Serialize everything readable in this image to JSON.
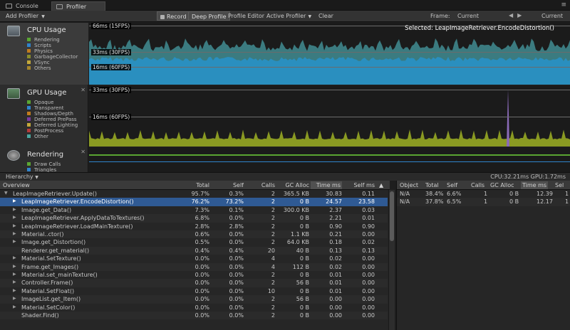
{
  "tabs": {
    "console": "Console",
    "profiler": "Profiler",
    "menu": "≡"
  },
  "toolbar": {
    "add_profiler": "Add Profiler",
    "record": "Record",
    "deep_profile": "Deep Profile",
    "profile_editor": "Profile Editor",
    "active_profiler": "Active Profiler",
    "clear": "Clear",
    "frame_label": "Frame:",
    "frame_value": "Current",
    "current_button": "Current"
  },
  "modules": {
    "cpu": {
      "title": "CPU Usage",
      "legend": [
        {
          "label": "Rendering",
          "color": "#5aa532"
        },
        {
          "label": "Scripts",
          "color": "#2f84cc"
        },
        {
          "label": "Physics",
          "color": "#c17c1d"
        },
        {
          "label": "GarbageCollector",
          "color": "#8a8d2c"
        },
        {
          "label": "VSync",
          "color": "#c3a83a"
        },
        {
          "label": "Others",
          "color": "#a6862b"
        }
      ]
    },
    "gpu": {
      "title": "GPU Usage",
      "legend": [
        {
          "label": "Opaque",
          "color": "#5aa532"
        },
        {
          "label": "Transparent",
          "color": "#2f84cc"
        },
        {
          "label": "Shadows/Depth",
          "color": "#c17c1d"
        },
        {
          "label": "Deferred PrePass",
          "color": "#7a3aa0"
        },
        {
          "label": "Deferred Lighting",
          "color": "#c3a83a"
        },
        {
          "label": "PostProcess",
          "color": "#b33a3a"
        },
        {
          "label": "Other",
          "color": "#4ba7a0"
        }
      ]
    },
    "rendering": {
      "title": "Rendering",
      "legend": [
        {
          "label": "Draw Calls",
          "color": "#5aa532"
        },
        {
          "label": "Triangles",
          "color": "#2f84cc"
        }
      ]
    }
  },
  "graphs": {
    "cpu_ref": [
      "66ms (15FPS)",
      "33ms (30FPS)",
      "16ms (60FPS)"
    ],
    "gpu_ref": [
      "33ms (30FPS)",
      "16ms (60FPS)"
    ],
    "selected": "Selected: LeapImageRetriever.EncodeDistortion()",
    "colors": {
      "cpu_fill": "#2a8fbf",
      "cpu_top": "#3b7b80",
      "gpu_fill": "#8a9a22",
      "gpu_spike": "#8a6ab8"
    }
  },
  "status": {
    "hierarchy": "Hierarchy",
    "cpu_gpu": "CPU:32.21ms   GPU:1.72ms"
  },
  "hierarchy": {
    "headers": {
      "overview": "Overview",
      "total": "Total",
      "self": "Self",
      "calls": "Calls",
      "gc_alloc": "GC Alloc",
      "time_ms": "Time ms",
      "self_ms": "Self ms",
      "sort": "▲"
    },
    "rows": [
      {
        "name": "LeapImageRetriever.Update()",
        "indent": 0,
        "expand": "open",
        "total": "95.7%",
        "self": "0.3%",
        "calls": "2",
        "gc": "365.5 KB",
        "time": "30.83",
        "selfms": "0.11"
      },
      {
        "name": "LeapImageRetriever.EncodeDistortion()",
        "indent": 1,
        "expand": "closed",
        "total": "76.2%",
        "self": "73.2%",
        "calls": "2",
        "gc": "0 B",
        "time": "24.57",
        "selfms": "23.58",
        "selected": true
      },
      {
        "name": "Image.get_Data()",
        "indent": 1,
        "expand": "closed",
        "total": "7.3%",
        "self": "0.1%",
        "calls": "2",
        "gc": "300.0 KB",
        "time": "2.37",
        "selfms": "0.03"
      },
      {
        "name": "LeapImageRetriever.ApplyDataToTextures()",
        "indent": 1,
        "expand": "closed",
        "total": "6.8%",
        "self": "0.0%",
        "calls": "2",
        "gc": "0 B",
        "time": "2.21",
        "selfms": "0.01"
      },
      {
        "name": "LeapImageRetriever.LoadMainTexture()",
        "indent": 1,
        "expand": "closed",
        "total": "2.8%",
        "self": "2.8%",
        "calls": "2",
        "gc": "0 B",
        "time": "0.90",
        "selfms": "0.90"
      },
      {
        "name": "Material..ctor()",
        "indent": 1,
        "expand": "closed",
        "total": "0.6%",
        "self": "0.0%",
        "calls": "2",
        "gc": "1.1 KB",
        "time": "0.21",
        "selfms": "0.00"
      },
      {
        "name": "Image.get_Distortion()",
        "indent": 1,
        "expand": "closed",
        "total": "0.5%",
        "self": "0.0%",
        "calls": "2",
        "gc": "64.0 KB",
        "time": "0.18",
        "selfms": "0.02"
      },
      {
        "name": "Renderer.get_material()",
        "indent": 1,
        "expand": "none",
        "total": "0.4%",
        "self": "0.4%",
        "calls": "20",
        "gc": "40 B",
        "time": "0.13",
        "selfms": "0.13"
      },
      {
        "name": "Material.SetTexture()",
        "indent": 1,
        "expand": "closed",
        "total": "0.0%",
        "self": "0.0%",
        "calls": "4",
        "gc": "0 B",
        "time": "0.02",
        "selfms": "0.00"
      },
      {
        "name": "Frame.get_Images()",
        "indent": 1,
        "expand": "closed",
        "total": "0.0%",
        "self": "0.0%",
        "calls": "4",
        "gc": "112 B",
        "time": "0.02",
        "selfms": "0.00"
      },
      {
        "name": "Material.set_mainTexture()",
        "indent": 1,
        "expand": "closed",
        "total": "0.0%",
        "self": "0.0%",
        "calls": "2",
        "gc": "0 B",
        "time": "0.01",
        "selfms": "0.00"
      },
      {
        "name": "Controller.Frame()",
        "indent": 1,
        "expand": "closed",
        "total": "0.0%",
        "self": "0.0%",
        "calls": "2",
        "gc": "56 B",
        "time": "0.01",
        "selfms": "0.00"
      },
      {
        "name": "Material.SetFloat()",
        "indent": 1,
        "expand": "closed",
        "total": "0.0%",
        "self": "0.0%",
        "calls": "10",
        "gc": "0 B",
        "time": "0.01",
        "selfms": "0.00"
      },
      {
        "name": "ImageList.get_Item()",
        "indent": 1,
        "expand": "closed",
        "total": "0.0%",
        "self": "0.0%",
        "calls": "2",
        "gc": "56 B",
        "time": "0.00",
        "selfms": "0.00"
      },
      {
        "name": "Material.SetColor()",
        "indent": 1,
        "expand": "closed",
        "total": "0.0%",
        "self": "0.0%",
        "calls": "2",
        "gc": "0 B",
        "time": "0.00",
        "selfms": "0.00"
      },
      {
        "name": "Shader.Find()",
        "indent": 1,
        "expand": "none",
        "total": "0.0%",
        "self": "0.0%",
        "calls": "2",
        "gc": "0 B",
        "time": "0.00",
        "selfms": "0.00"
      }
    ]
  },
  "objects": {
    "headers": {
      "object": "Object",
      "total": "Total",
      "self": "Self",
      "calls": "Calls",
      "gc_alloc": "GC Alloc",
      "time_ms": "Time ms",
      "self_ms": "Sel"
    },
    "rows": [
      {
        "object": "N/A",
        "total": "38.4%",
        "self": "6.6%",
        "calls": "1",
        "gc": "0 B",
        "time": "12.39",
        "self_ms": "1"
      },
      {
        "object": "N/A",
        "total": "37.8%",
        "self": "6.5%",
        "calls": "1",
        "gc": "0 B",
        "time": "12.17",
        "self_ms": "1"
      }
    ]
  }
}
